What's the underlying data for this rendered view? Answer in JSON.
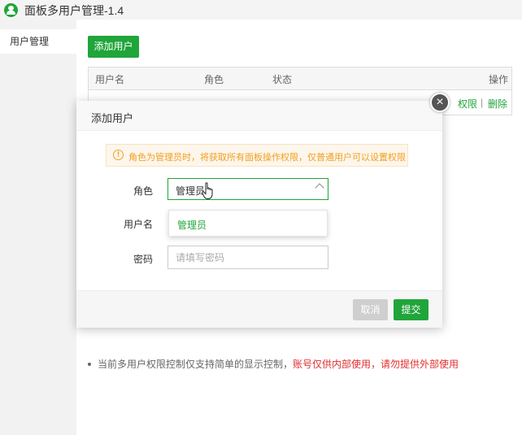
{
  "app": {
    "title": "面板多用户管理-1.4"
  },
  "sidebar": {
    "items": [
      {
        "label": "用户管理"
      }
    ]
  },
  "toolbar": {
    "add_user_label": "添加用户"
  },
  "table": {
    "headers": [
      "用户名",
      "角色",
      "状态",
      "操作"
    ],
    "row_actions": [
      "权限",
      "删除"
    ],
    "separator": "|"
  },
  "note": {
    "text": "当前多用户权限控制仅支持简单的显示控制，",
    "warning": "账号仅供内部使用，请勿提供外部使用"
  },
  "dialog": {
    "title": "添加用户",
    "close_icon": "×",
    "warning_icon": "!",
    "warning": "角色为管理员时，将获取所有面板操作权限，仅普通用户可以设置权限",
    "role_label": "角色",
    "role_value": "管理员",
    "role_options": [
      "管理员"
    ],
    "username_label": "用户名",
    "password_label": "密码",
    "password_placeholder": "请填写密码",
    "cancel_label": "取消",
    "submit_label": "提交"
  },
  "colors": {
    "accent": "#20a53a",
    "warning": "#f0a020",
    "danger": "#e22d2d"
  }
}
